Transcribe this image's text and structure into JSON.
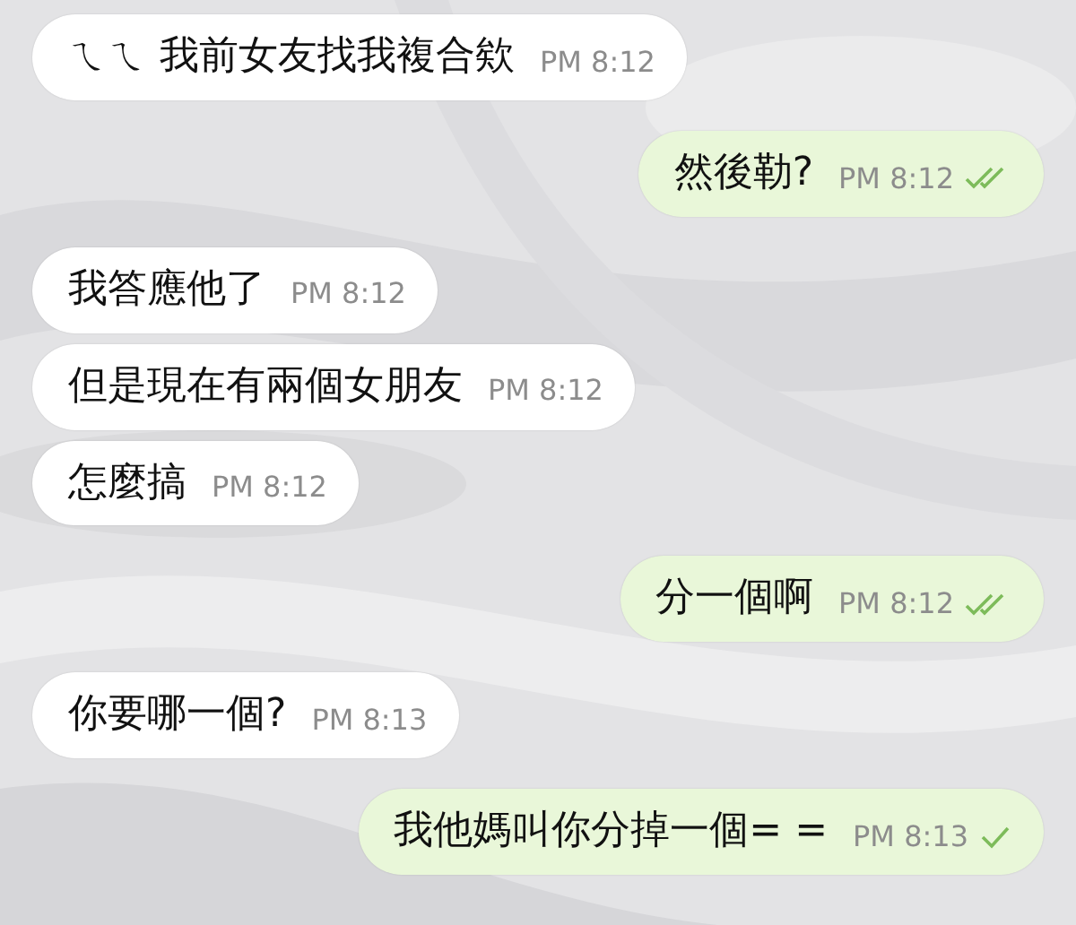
{
  "messages": [
    {
      "kind": "incoming",
      "text": "ㄟㄟ 我前女友找我複合欸",
      "time": "PM 8:12"
    },
    {
      "kind": "outgoing",
      "text": "然後勒?",
      "time": "PM 8:12",
      "read": true
    },
    {
      "kind": "incoming",
      "text": "我答應他了",
      "time": "PM 8:12"
    },
    {
      "kind": "incoming",
      "text": "但是現在有兩個女朋友",
      "time": "PM 8:12"
    },
    {
      "kind": "incoming",
      "text": "怎麼搞",
      "time": "PM 8:12"
    },
    {
      "kind": "outgoing",
      "text": "分一個啊",
      "time": "PM 8:12",
      "read": true
    },
    {
      "kind": "incoming",
      "text": "你要哪一個?",
      "time": "PM 8:13"
    },
    {
      "kind": "outgoing",
      "text": "我他媽叫你分掉一個= =",
      "time": "PM 8:13",
      "read": false
    }
  ]
}
